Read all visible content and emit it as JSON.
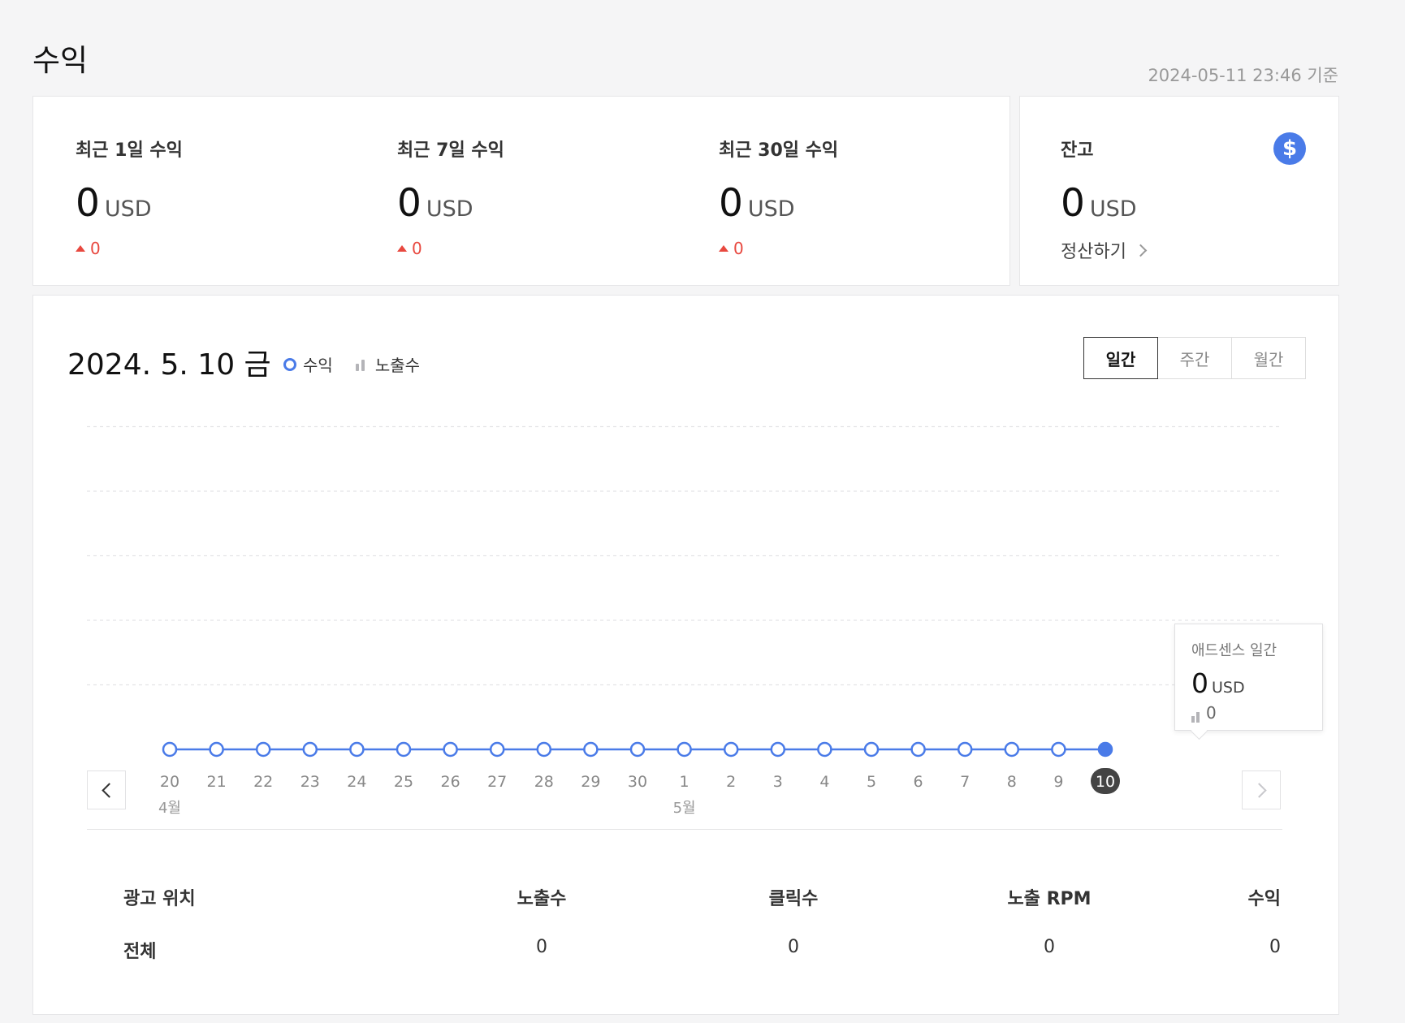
{
  "page": {
    "title": "수익",
    "timestamp": "2024-05-11 23:46 기준"
  },
  "summary": [
    {
      "label": "최근 1일 수익",
      "value": "0",
      "unit": "USD",
      "change": "0"
    },
    {
      "label": "최근 7일 수익",
      "value": "0",
      "unit": "USD",
      "change": "0"
    },
    {
      "label": "최근 30일 수익",
      "value": "0",
      "unit": "USD",
      "change": "0"
    }
  ],
  "balance": {
    "label": "잔고",
    "value": "0",
    "unit": "USD",
    "settle_link": "정산하기",
    "icon": "dollar-icon",
    "icon_glyph": "$",
    "icon_color": "#4a7be8"
  },
  "chart": {
    "date": "2024. 5. 10 금",
    "legend": {
      "revenue": "수익",
      "impressions": "노출수"
    },
    "tabs": [
      "일간",
      "주간",
      "월간"
    ],
    "active_tab": "일간",
    "tooltip": {
      "title": "애드센스 일간",
      "value": "0",
      "unit": "USD",
      "impressions": "0"
    }
  },
  "chart_data": {
    "type": "line",
    "x": [
      "20",
      "21",
      "22",
      "23",
      "24",
      "25",
      "26",
      "27",
      "28",
      "29",
      "30",
      "1",
      "2",
      "3",
      "4",
      "5",
      "6",
      "7",
      "8",
      "9",
      "10"
    ],
    "month_labels": [
      {
        "at": "20",
        "label": "4월"
      },
      {
        "at": "1",
        "label": "5월"
      }
    ],
    "series": [
      {
        "name": "수익",
        "values": [
          0,
          0,
          0,
          0,
          0,
          0,
          0,
          0,
          0,
          0,
          0,
          0,
          0,
          0,
          0,
          0,
          0,
          0,
          0,
          0,
          0
        ]
      }
    ],
    "selected": "10",
    "grid": true,
    "color": "#4a7be8"
  },
  "table": {
    "headers": [
      "광고 위치",
      "노출수",
      "클릭수",
      "노출 RPM",
      "수익"
    ],
    "rows": [
      [
        "전체",
        "0",
        "0",
        "0",
        "0"
      ]
    ]
  }
}
